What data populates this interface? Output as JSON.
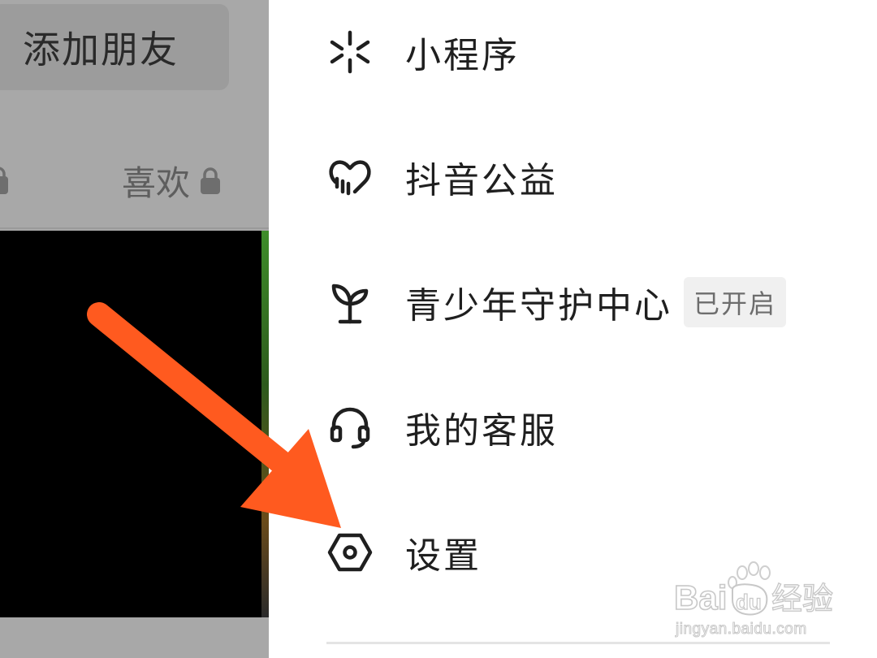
{
  "profile": {
    "add_friend_label": "添加朋友",
    "tabs": {
      "likes_label": "喜欢"
    }
  },
  "menu": {
    "items": [
      {
        "label": "小程序",
        "icon": "mini-program-icon"
      },
      {
        "label": "抖音公益",
        "icon": "charity-heart-icon"
      },
      {
        "label": "青少年守护中心",
        "icon": "sprout-icon",
        "badge": "已开启"
      },
      {
        "label": "我的客服",
        "icon": "headset-icon"
      },
      {
        "label": "设置",
        "icon": "settings-hexagon-icon"
      }
    ]
  },
  "watermark": {
    "brand": "Bai",
    "paw_text": "du",
    "suffix": "经验",
    "url": "jingyan.baidu.com"
  },
  "colors": {
    "arrow": "#ff5a1f",
    "overlay": "#a8a8a8",
    "text": "#1f1f1f",
    "badge_bg": "#f0f0f0"
  }
}
